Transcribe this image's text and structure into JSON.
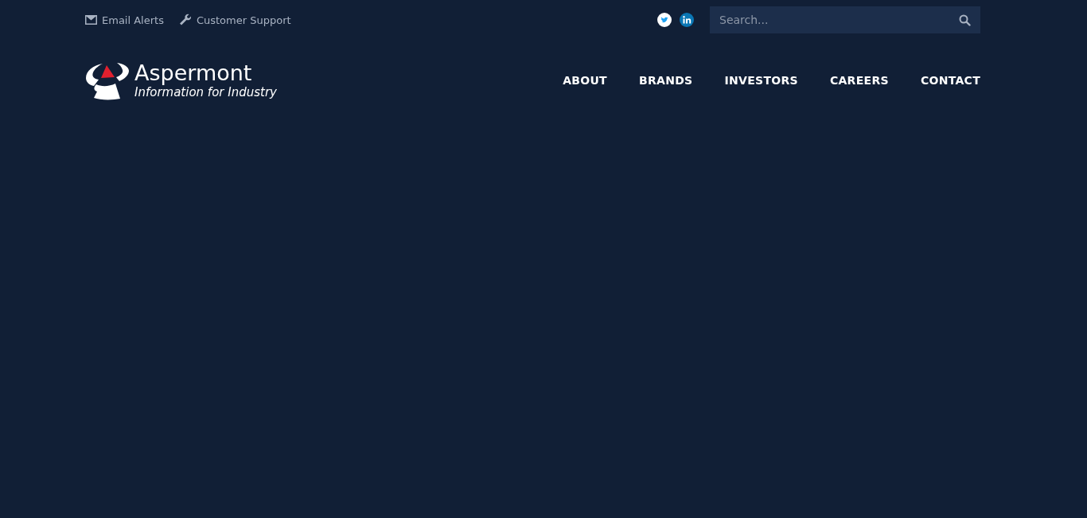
{
  "top_links": [
    {
      "kind": "email",
      "label": "Email Alerts"
    },
    {
      "kind": "support",
      "label": "Customer Support"
    }
  ],
  "social": [
    {
      "kind": "twitter"
    },
    {
      "kind": "linkedin"
    }
  ],
  "search": {
    "placeholder": "Search..."
  },
  "logo": {
    "name": "Aspermont",
    "tagline": "Information for Industry"
  },
  "nav": [
    {
      "label": "ABOUT"
    },
    {
      "label": "BRANDS"
    },
    {
      "label": "INVESTORS"
    },
    {
      "label": "CAREERS"
    },
    {
      "label": "CONTACT"
    }
  ]
}
